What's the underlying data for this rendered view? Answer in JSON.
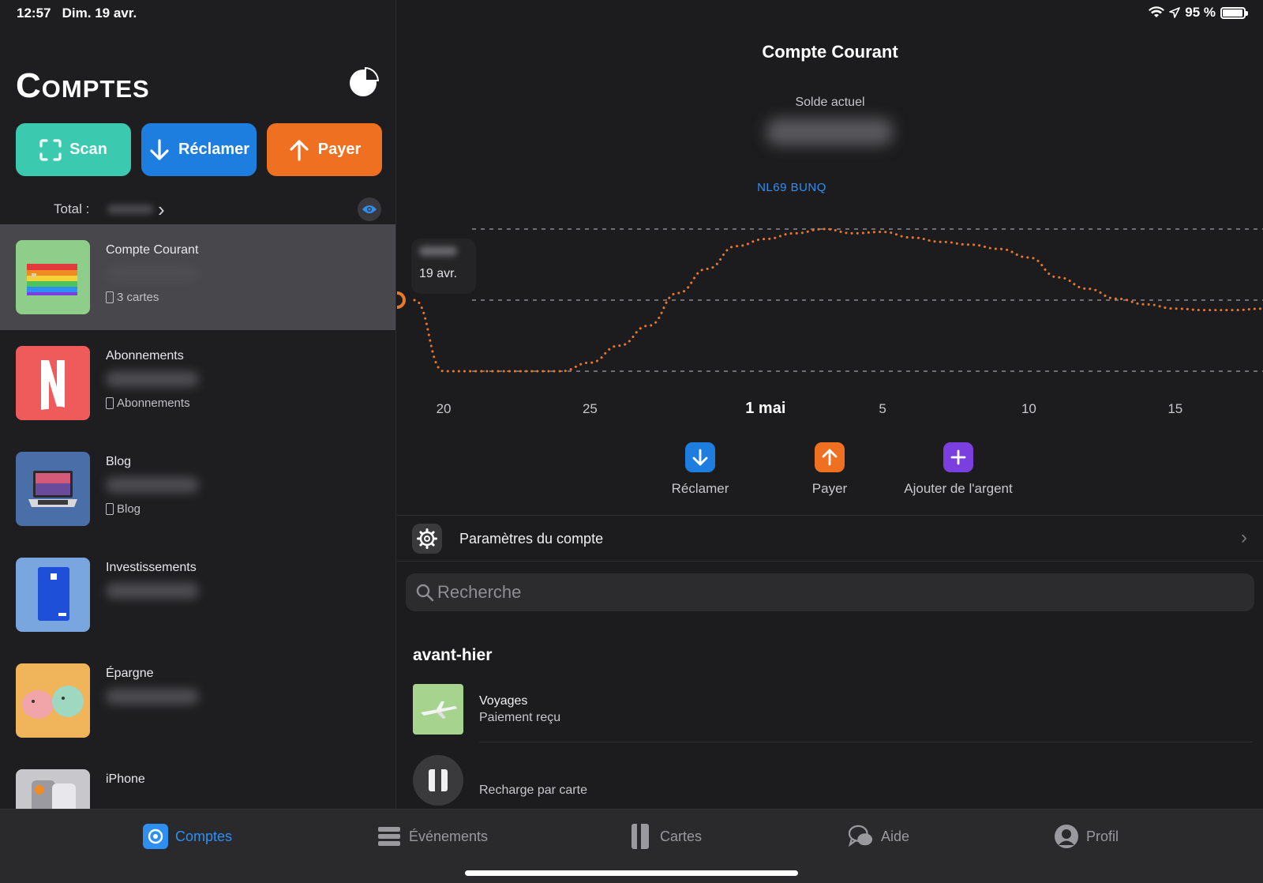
{
  "status_bar": {
    "time": "12:57",
    "date": "Dim. 19 avr.",
    "battery": "95 %"
  },
  "sidebar": {
    "title": "Comptes",
    "actions": [
      {
        "label": "Scan",
        "icon": "scan-icon",
        "color": "#3bc9b0"
      },
      {
        "label": "Réclamer",
        "icon": "arrow-down-icon",
        "color": "#1e7ee0"
      },
      {
        "label": "Payer",
        "icon": "arrow-up-icon",
        "color": "#f07022"
      }
    ],
    "total_label": "Total :",
    "accounts": [
      {
        "name": "Compte Courant",
        "sub": "3 cartes",
        "thumb": "rainbow-cards"
      },
      {
        "name": "Abonnements",
        "sub": "Abonnements",
        "thumb": "netflix-logo"
      },
      {
        "name": "Blog",
        "sub": "Blog",
        "thumb": "laptop"
      },
      {
        "name": "Investissements",
        "sub": "",
        "thumb": "blue-card"
      },
      {
        "name": "Épargne",
        "sub": "",
        "thumb": "piggy-banks"
      },
      {
        "name": "iPhone",
        "sub": "",
        "thumb": "iphone"
      }
    ]
  },
  "detail": {
    "title": "Compte Courant",
    "solde_label": "Solde actuel",
    "iban": "NL69 BUNQ",
    "tooltip_date": "19 avr.",
    "quick_actions": [
      {
        "label": "Réclamer",
        "icon": "arrow-down-icon",
        "color": "#1e7ee0"
      },
      {
        "label": "Payer",
        "icon": "arrow-up-icon",
        "color": "#f07022"
      },
      {
        "label": "Ajouter de l'argent",
        "icon": "plus-icon",
        "color": "#7b3fe0"
      }
    ],
    "settings_label": "Paramètres du compte",
    "search_placeholder": "Recherche",
    "section_header": "avant-hier",
    "transactions": [
      {
        "title": "Voyages",
        "sub": "Paiement reçu",
        "thumb": "airplane"
      },
      {
        "title": "",
        "sub": "Recharge par carte",
        "thumb": "card-icon"
      }
    ]
  },
  "chart_data": {
    "type": "line",
    "x_tick_labels": [
      "20",
      "25",
      "1 mai",
      "5",
      "10",
      "15"
    ],
    "x_tick_days": [
      1,
      6,
      12,
      16,
      21,
      26
    ],
    "highlighted_tick": "1 mai",
    "x": [
      0,
      1,
      2,
      3,
      4,
      5,
      6,
      7,
      8,
      9,
      10,
      11,
      12,
      13,
      14,
      15,
      16,
      17,
      18,
      19,
      20,
      21,
      22,
      23,
      24,
      25,
      26,
      27,
      28,
      29
    ],
    "y": [
      0.5,
      0.0,
      0.0,
      0.0,
      0.0,
      0.0,
      0.06,
      0.18,
      0.32,
      0.55,
      0.72,
      0.88,
      0.93,
      0.97,
      1.0,
      0.97,
      0.98,
      0.94,
      0.91,
      0.89,
      0.86,
      0.8,
      0.66,
      0.58,
      0.51,
      0.47,
      0.44,
      0.43,
      0.43,
      0.44
    ],
    "ylim": [
      0,
      1
    ],
    "gridlines": 3,
    "line_color": "#e8782c",
    "grid": true
  },
  "tab_bar": {
    "items": [
      {
        "label": "Comptes",
        "icon": "accounts-icon",
        "active": true
      },
      {
        "label": "Événements",
        "icon": "events-icon",
        "active": false
      },
      {
        "label": "Cartes",
        "icon": "cards-icon",
        "active": false
      },
      {
        "label": "Aide",
        "icon": "chat-icon",
        "active": false
      },
      {
        "label": "Profil",
        "icon": "profile-icon",
        "active": false
      }
    ]
  },
  "colors": {
    "accent": "#2f8ff0",
    "background": "#1c1c1e",
    "chart_line": "#e8782c"
  }
}
